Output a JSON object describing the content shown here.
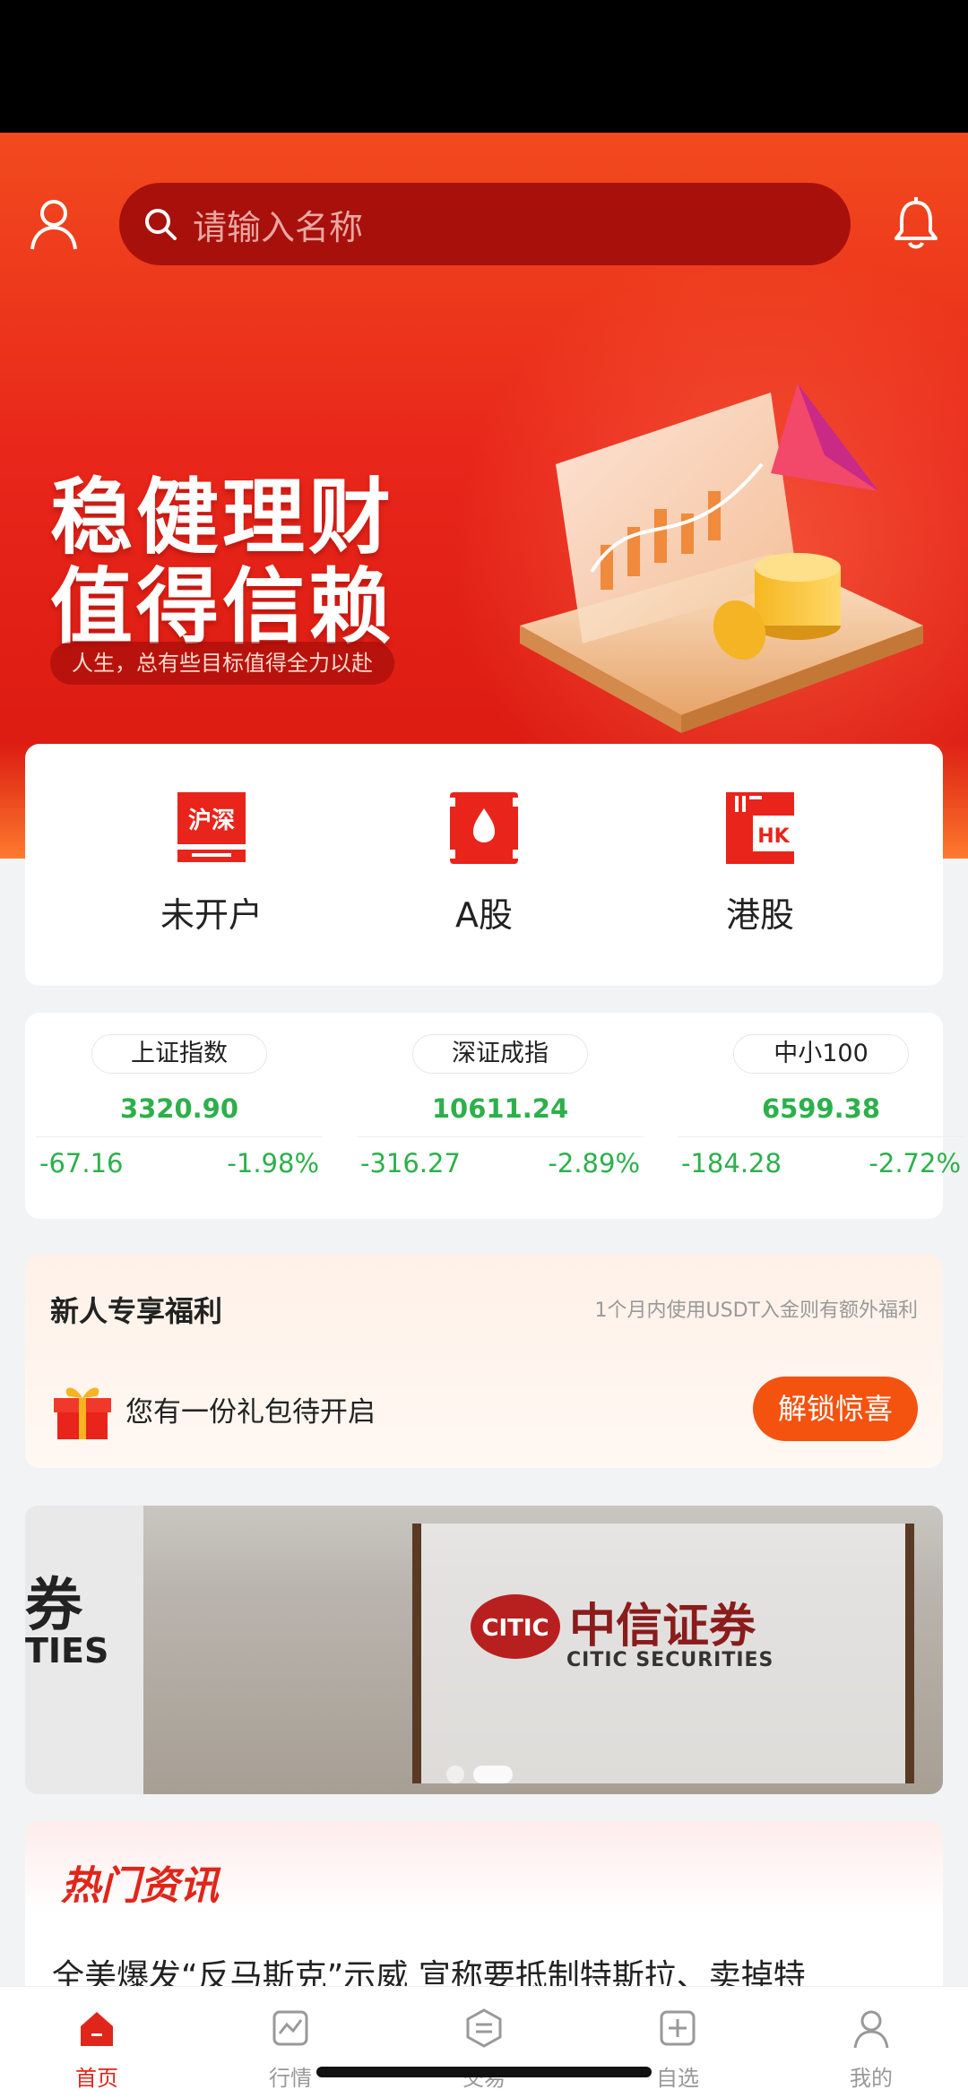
{
  "search": {
    "placeholder": "请输入名称"
  },
  "hero": {
    "title_line1": "稳健理财",
    "title_line2": "值得信赖",
    "subtitle": "人生，总有些目标值得全力以赴"
  },
  "quick_entries": [
    {
      "label": "未开户",
      "icon": "hushen-icon",
      "icon_text": "沪深"
    },
    {
      "label": "A股",
      "icon": "a-share-icon"
    },
    {
      "label": "港股",
      "icon": "hk-icon",
      "icon_text": "HK"
    }
  ],
  "indices": [
    {
      "name": "上证指数",
      "value": "3320.90",
      "change": "-67.16",
      "percent": "-1.98%"
    },
    {
      "name": "深证成指",
      "value": "10611.24",
      "change": "-316.27",
      "percent": "-2.89%"
    },
    {
      "name": "中小100",
      "value": "6599.38",
      "change": "-184.28",
      "percent": "-2.72%"
    }
  ],
  "welfare": {
    "title": "新人专享福利",
    "note": "1个月内使用USDT入金则有额外福利",
    "gift_text": "您有一份礼包待开启",
    "button": "解锁惊喜"
  },
  "banner": {
    "left_text": "券",
    "left_en": "TIES",
    "brand_cn": "中信证券",
    "brand_en": "CITIC SECURITIES"
  },
  "news": {
    "title": "热门资讯",
    "headline": "全美爆发“反马斯克”示威 宣称要抵制特斯拉、卖掉特"
  },
  "tabbar": [
    {
      "label": "首页",
      "icon": "home-icon",
      "active": true
    },
    {
      "label": "行情",
      "icon": "market-icon",
      "active": false
    },
    {
      "label": "交易",
      "icon": "trade-icon",
      "active": false
    },
    {
      "label": "自选",
      "icon": "watchlist-icon",
      "active": false
    },
    {
      "label": "我的",
      "icon": "profile-icon",
      "active": false
    }
  ],
  "colors": {
    "brand_red": "#e0261b",
    "up_green": "#2db04c",
    "orange": "#f4520f"
  }
}
